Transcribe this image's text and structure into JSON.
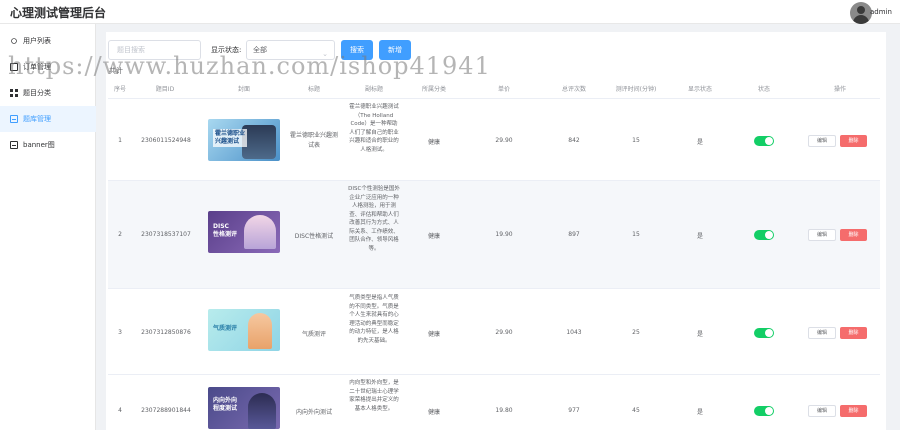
{
  "app": {
    "title": "心理测试管理后台",
    "username": "admin"
  },
  "sidebar": {
    "items": [
      {
        "label": "用户列表",
        "icon": "user-icon",
        "active": false
      },
      {
        "label": "订单管理",
        "icon": "order-icon",
        "active": false
      },
      {
        "label": "题目分类",
        "icon": "grid-icon",
        "active": false
      },
      {
        "label": "题库管理",
        "icon": "document-icon",
        "active": true
      },
      {
        "label": "banner图",
        "icon": "document-icon",
        "active": false
      }
    ]
  },
  "toolbar": {
    "search_placeholder": "题目搜索",
    "status_label": "显示状态:",
    "status_value": "全部",
    "search_button": "搜索",
    "add_button": "新增",
    "total_label": "共计"
  },
  "table": {
    "columns": [
      "序号",
      "题目ID",
      "封面",
      "标题",
      "副标题",
      "所属分类",
      "单价",
      "总评次数",
      "测评时间(分钟)",
      "显示状态",
      "状态",
      "操作"
    ],
    "rows": [
      {
        "index": "1",
        "id": "2306011524948",
        "cover_text": "霍兰德职业\n兴趣测试",
        "title": "霍兰德职业兴趣测试表",
        "subtitle": "霍兰德职业兴趣测试（The Holland Code）是一种帮助人们了解自己的职业兴趣和适合的职业的人格测试。",
        "category": "健康",
        "price": "29.90",
        "count": "842",
        "minutes": "15",
        "display": "是",
        "enabled": true
      },
      {
        "index": "2",
        "id": "2307318537107",
        "cover_text": "DISC\n性格测评",
        "title": "DISC性格测试",
        "subtitle": "DISC个性测验是国外企业广泛应用的一种人格测验，用于测查、评估和帮助人们改善其行为方式、人际关系、工作绩效、团队合作、领导风格等。",
        "category": "健康",
        "price": "19.90",
        "count": "897",
        "minutes": "15",
        "display": "是",
        "enabled": true
      },
      {
        "index": "3",
        "id": "2307312850876",
        "cover_text": "气质测评",
        "title": "气质测评",
        "subtitle": "气质类型是指人气质的不同类型。气质是个人生来就具有的心理活动的典型而稳定的动力特征，是人格的先天基础。",
        "category": "健康",
        "price": "29.90",
        "count": "1043",
        "minutes": "25",
        "display": "是",
        "enabled": true
      },
      {
        "index": "4",
        "id": "2307288901844",
        "cover_text": "内向外向\n程度测试",
        "title": "内向外向测试",
        "subtitle": "内向型和外向型，是二十世纪瑞士心理学家荣格提出并定义的基本人格类型。",
        "category": "健康",
        "price": "19.80",
        "count": "977",
        "minutes": "45",
        "display": "是",
        "enabled": true
      }
    ],
    "edit_label": "编辑",
    "delete_label": "删除"
  },
  "watermark": "https://www.huzhan.com/ishop41941",
  "colors": {
    "primary": "#409eff",
    "danger": "#f56c6c",
    "success": "#13ce66",
    "active_bg": "#ecf5ff"
  }
}
